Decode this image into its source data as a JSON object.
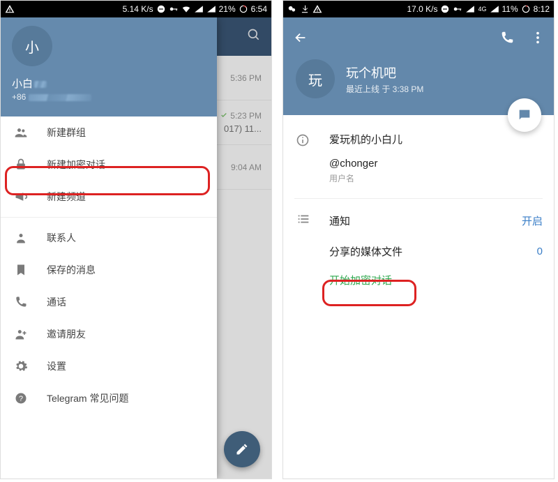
{
  "left": {
    "statusbar": {
      "speed": "5.14 K/s",
      "battery": "21%",
      "time": "6:54"
    },
    "drawer": {
      "avatar_letter": "小",
      "username": "小白",
      "phone": "+86",
      "items": [
        {
          "id": "new-group",
          "label": "新建群组"
        },
        {
          "id": "new-secret",
          "label": "新建加密对话"
        },
        {
          "id": "new-channel",
          "label": "新建频道"
        },
        {
          "id": "contacts",
          "label": "联系人"
        },
        {
          "id": "saved-messages",
          "label": "保存的消息"
        },
        {
          "id": "calls",
          "label": "通话"
        },
        {
          "id": "invite",
          "label": "邀请朋友"
        },
        {
          "id": "settings",
          "label": "设置"
        },
        {
          "id": "faq",
          "label": "Telegram 常见问题"
        }
      ]
    },
    "chat_preview": {
      "row0_time": "5:36 PM",
      "row1_time": "5:23 PM",
      "row1_text": "017) 11...",
      "row2_time": "9:04 AM"
    }
  },
  "right": {
    "statusbar": {
      "speed": "17.0 K/s",
      "network": "4G",
      "battery": "11%",
      "time": "8:12"
    },
    "profile": {
      "avatar_letter": "玩",
      "title": "玩个机吧",
      "status": "最近上线 于 3:38 PM",
      "bio": "爱玩机的小白儿",
      "username": "@chonger",
      "username_caption": "用户名",
      "notifications_label": "通知",
      "notifications_value": "开启",
      "shared_media_label": "分享的媒体文件",
      "shared_media_value": "0",
      "start_secret_chat": "开始加密对话"
    }
  }
}
